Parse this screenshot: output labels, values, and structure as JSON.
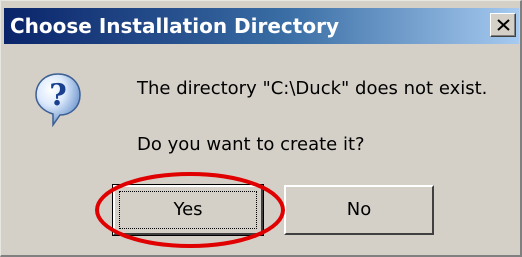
{
  "window": {
    "title": "Choose Installation Directory",
    "close_icon": "close-icon"
  },
  "dialog": {
    "icon": "question-icon",
    "message_line1": "The directory \"C:\\Duck\" does not exist.",
    "message_line2": "Do you want to create it?"
  },
  "buttons": {
    "yes_label": "Yes",
    "no_label": "No"
  },
  "annotation": {
    "type": "red-ellipse-highlight",
    "target": "Yes",
    "color": "#e00000"
  },
  "colors": {
    "titlebar_start": "#0a246a",
    "titlebar_end": "#a6caf0",
    "dialog_bg": "#d4d0c8"
  }
}
